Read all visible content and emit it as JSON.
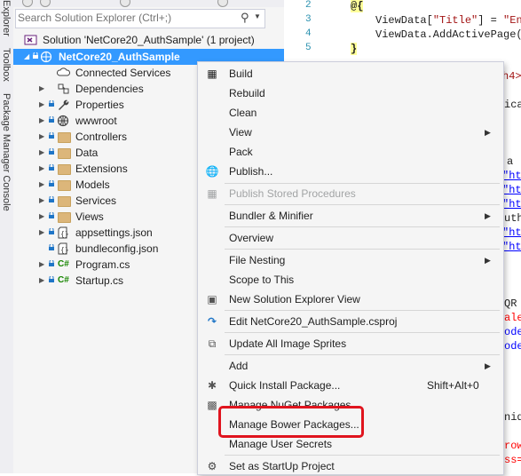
{
  "side_strip": {
    "tabs": [
      "Explorer",
      "Toolbox",
      "Package Manager Console"
    ]
  },
  "solution_explorer": {
    "search_placeholder": "Search Solution Explorer (Ctrl+;)",
    "solution_label": "Solution 'NetCore20_AuthSample' (1 project)",
    "project_label": "NetCore20_AuthSample",
    "items": [
      {
        "label": "Connected Services",
        "icon": "connected-services-icon"
      },
      {
        "label": "Dependencies",
        "icon": "dependencies-icon"
      },
      {
        "label": "Properties",
        "icon": "wrench-icon"
      },
      {
        "label": "wwwroot",
        "icon": "globe-icon"
      },
      {
        "label": "Controllers",
        "icon": "folder-icon"
      },
      {
        "label": "Data",
        "icon": "folder-icon"
      },
      {
        "label": "Extensions",
        "icon": "folder-icon"
      },
      {
        "label": "Models",
        "icon": "folder-icon"
      },
      {
        "label": "Services",
        "icon": "folder-icon"
      },
      {
        "label": "Views",
        "icon": "folder-icon"
      },
      {
        "label": "appsettings.json",
        "icon": "json-file-icon"
      },
      {
        "label": "bundleconfig.json",
        "icon": "json-file-icon"
      },
      {
        "label": "Program.cs",
        "icon": "csharp-file-icon"
      },
      {
        "label": "Startup.cs",
        "icon": "csharp-file-icon"
      }
    ]
  },
  "editor": {
    "line_numbers": [
      "2",
      "3",
      "4",
      "5"
    ],
    "line2": "@{",
    "line3_a": "ViewData[",
    "line3_b": "\"Title\"",
    "line3_c": "] = ",
    "line3_d": "\"En",
    "line4": "ViewData.AddActivePage(",
    "line5": "}",
    "fragments": [
      "h4>",
      "ica",
      "a",
      "\"ht",
      "\"ht",
      "\"ht",
      "uth",
      "\"ht",
      "\"ht",
      "QR",
      "ale",
      "ode",
      "ode",
      "nid",
      "row",
      "ss="
    ]
  },
  "context_menu": {
    "build": "Build",
    "rebuild": "Rebuild",
    "clean": "Clean",
    "view": "View",
    "pack": "Pack",
    "publish": "Publish...",
    "publish_stored": "Publish Stored Procedures",
    "bundler": "Bundler & Minifier",
    "overview": "Overview",
    "file_nesting": "File Nesting",
    "scope": "Scope to This",
    "new_se_view": "New Solution Explorer View",
    "edit_csproj": "Edit NetCore20_AuthSample.csproj",
    "update_sprites": "Update All Image Sprites",
    "add": "Add",
    "quick_install": "Quick Install Package...",
    "quick_install_shortcut": "Shift+Alt+0",
    "manage_nuget": "Manage NuGet Packages...",
    "manage_bower": "Manage Bower Packages...",
    "manage_secrets": "Manage User Secrets",
    "startup_project": "Set as StartUp Project"
  },
  "colors": {
    "selection": "#3399ff",
    "highlight_box": "#e0141e",
    "line_numbers": "#2b91af",
    "string": "#a31515"
  }
}
